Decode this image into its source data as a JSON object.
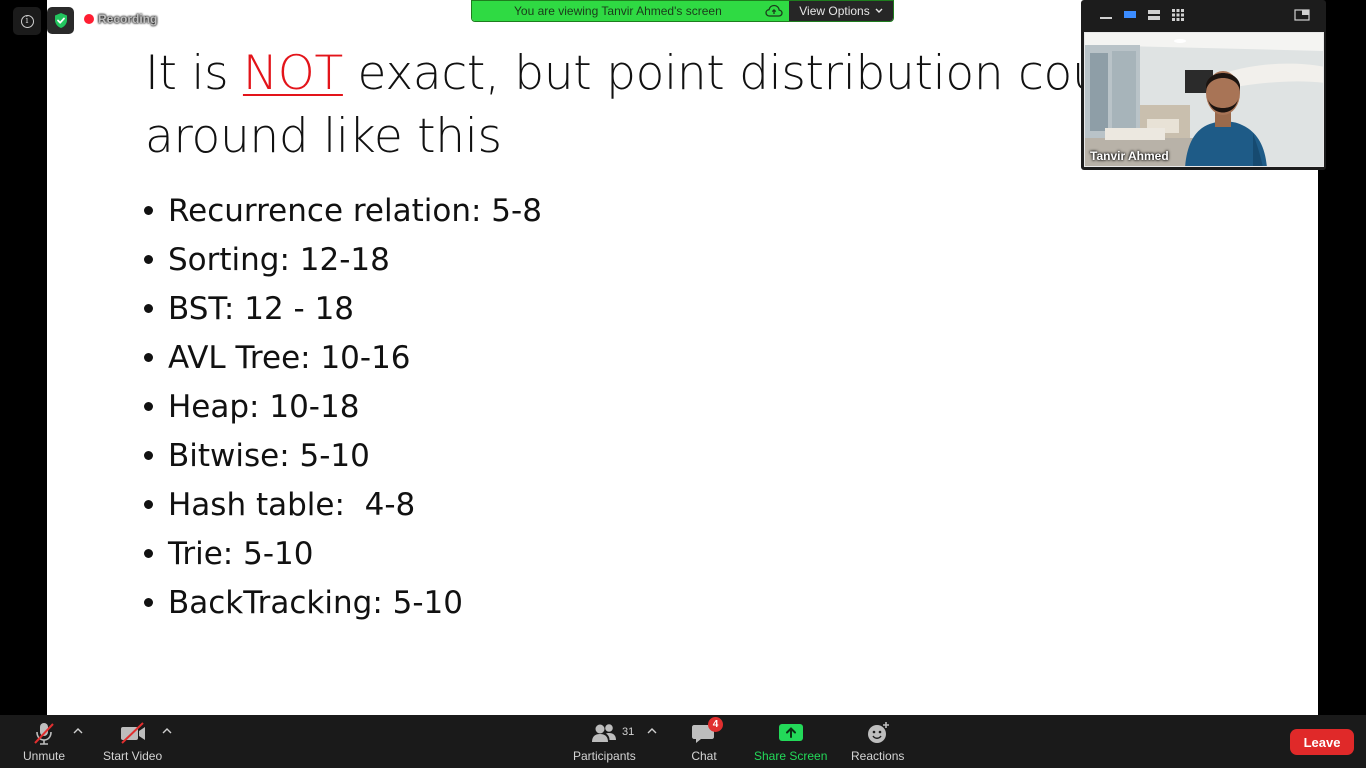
{
  "slide": {
    "title_line1_before": "It is ",
    "title_line1_highlight": "NOT",
    "title_line1_after": " exact, but point distribution cou",
    "title_line2": "around like this",
    "bullets": [
      "Recurrence relation: 5-8",
      "Sorting: 12-18",
      "BST: 12 - 18",
      "AVL Tree: 10-16",
      "Heap: 10-18",
      "Bitwise: 5-10",
      "Hash table:  4-8",
      "Trie: 5-10",
      "BackTracking: 5-10"
    ],
    "highlight_color": "#e3141a"
  },
  "status": {
    "recording_label": "Recording"
  },
  "banner": {
    "message": "You are viewing Tanvir Ahmed's screen",
    "view_options_label": "View Options"
  },
  "video": {
    "participant_name": "Tanvir Ahmed"
  },
  "toolbar": {
    "unmute_label": "Unmute",
    "start_video_label": "Start Video",
    "participants_label": "Participants",
    "participants_count": "31",
    "chat_label": "Chat",
    "chat_badge": "4",
    "share_screen_label": "Share Screen",
    "reactions_label": "Reactions",
    "leave_label": "Leave"
  },
  "colors": {
    "banner_green": "#2fda43",
    "share_green": "#23d959",
    "leave_red": "#e02929",
    "recording_red": "#ff1e32"
  }
}
